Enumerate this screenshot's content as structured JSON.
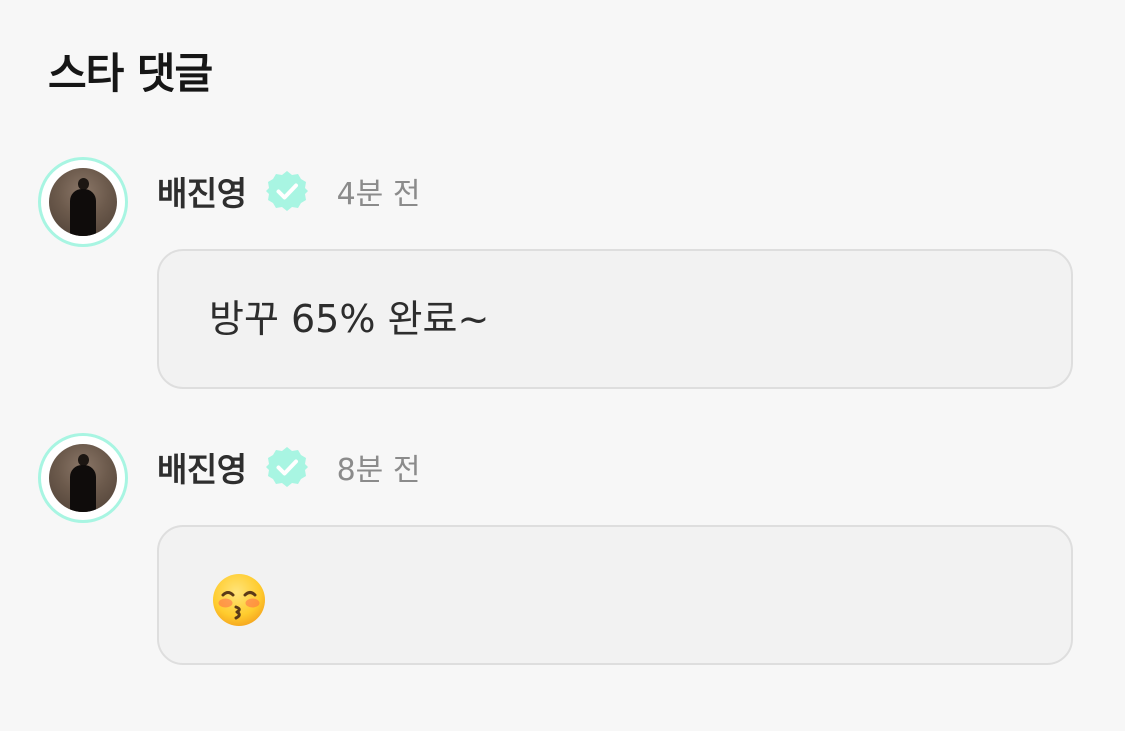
{
  "section": {
    "title": "스타 댓글"
  },
  "comments": [
    {
      "author": "배진영",
      "time": "4분 전",
      "text": "방꾸 65% 완료~",
      "verified_icon": "verified-badge-icon"
    },
    {
      "author": "배진영",
      "time": "8분 전",
      "text": "😚",
      "verified_icon": "verified-badge-icon"
    }
  ],
  "colors": {
    "accent": "#a8f5e2",
    "badge": "#a8f5e2",
    "background": "#f7f7f7",
    "bubble": "#f2f2f2"
  }
}
